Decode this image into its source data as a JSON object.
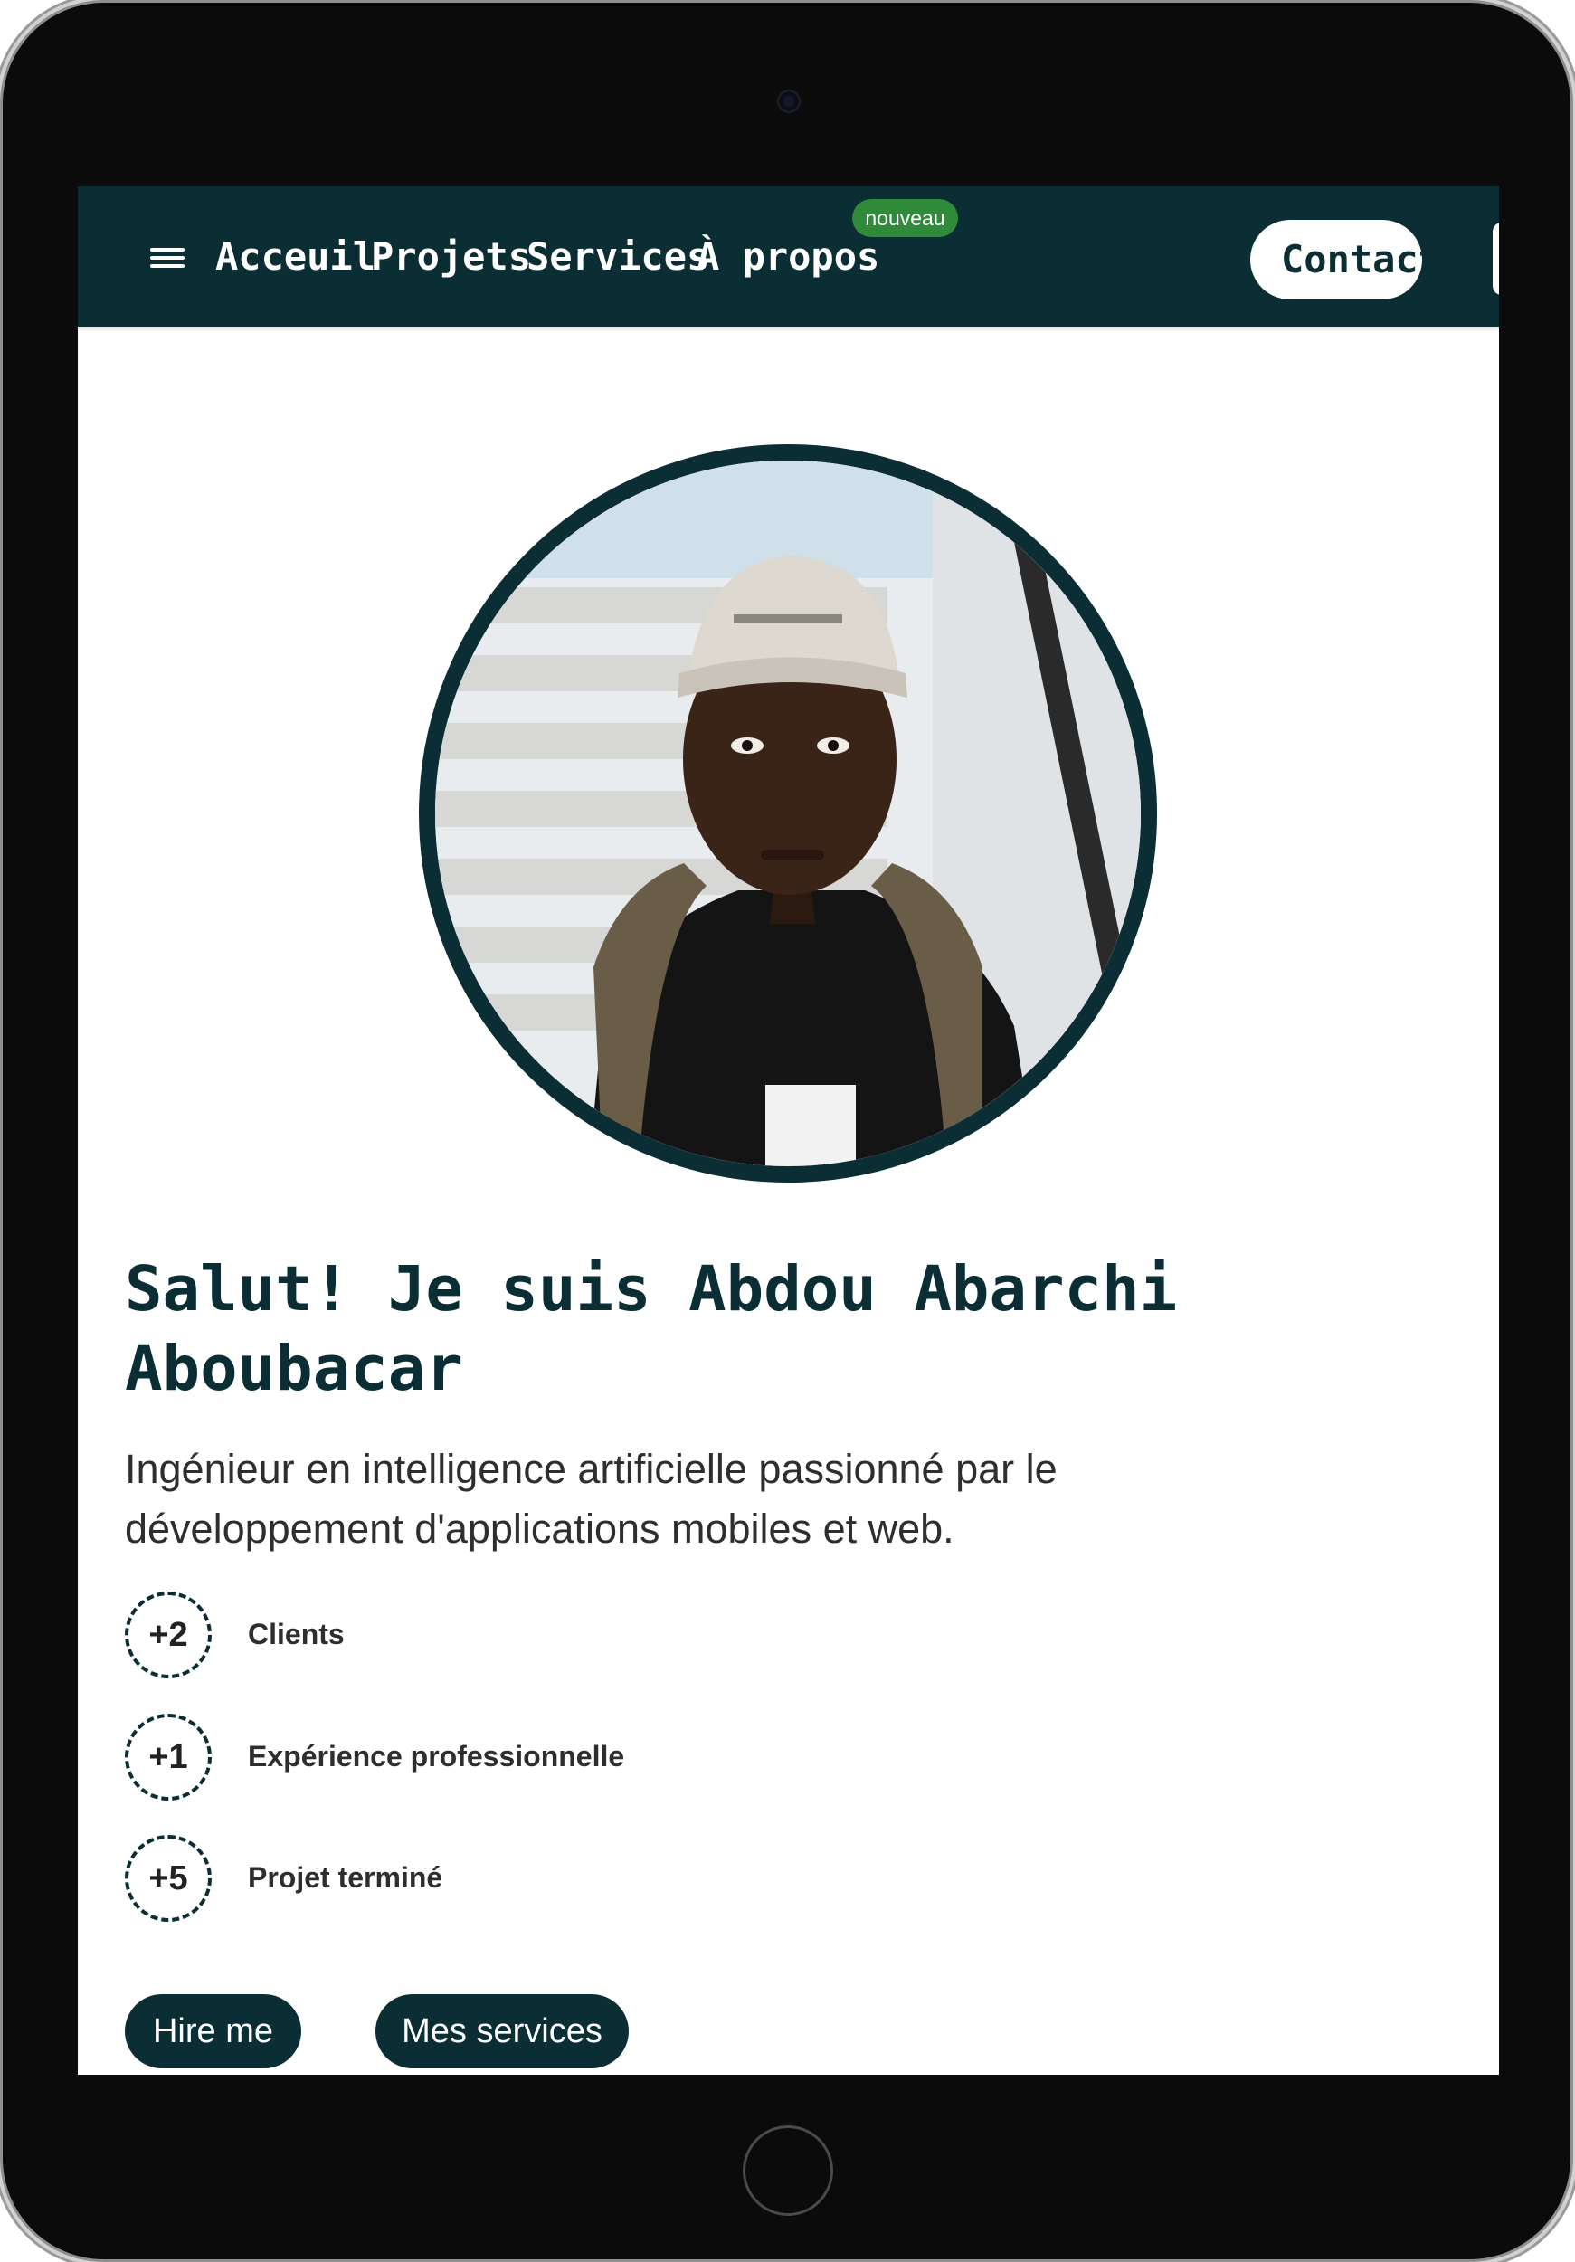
{
  "nav": {
    "links": [
      "Acceuil",
      "Projets",
      "Services",
      "À propos"
    ],
    "badge": "nouveau",
    "contact_label": "Contact",
    "menu_icon": "hamburger-menu-icon"
  },
  "hero": {
    "title": "Salut! Je suis Abdou Abarchi Aboubacar",
    "subtitle": "Ingénieur en intelligence artificielle passionné par le développement d'applications mobiles et web.",
    "stats": [
      {
        "value": "+2",
        "label": "Clients"
      },
      {
        "value": "+1",
        "label": "Expérience professionnelle"
      },
      {
        "value": "+5",
        "label": "Projet terminé"
      }
    ],
    "buttons": [
      "Hire me",
      "Mes services"
    ]
  },
  "colors": {
    "primary": "#0b2e35",
    "badge": "#2f8a3a",
    "device": "#0b0b0b",
    "text": "#2e2e2e"
  }
}
